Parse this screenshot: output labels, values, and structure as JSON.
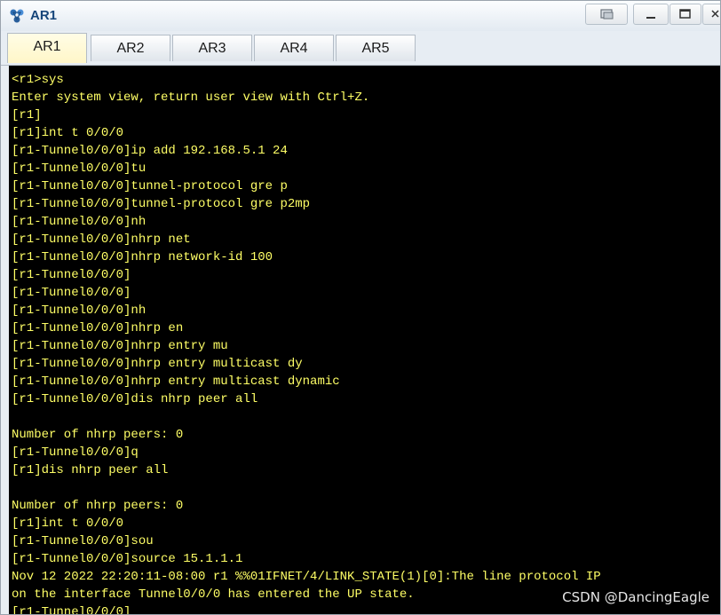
{
  "window": {
    "title": "AR1"
  },
  "tabs": [
    {
      "label": "AR1",
      "active": true
    },
    {
      "label": "AR2",
      "active": false
    },
    {
      "label": "AR3",
      "active": false
    },
    {
      "label": "AR4",
      "active": false
    },
    {
      "label": "AR5",
      "active": false
    }
  ],
  "terminal": {
    "text_color": "#ffff66",
    "background": "#000000",
    "lines": [
      "<r1>sys",
      "Enter system view, return user view with Ctrl+Z.",
      "[r1]",
      "[r1]int t 0/0/0",
      "[r1-Tunnel0/0/0]ip add 192.168.5.1 24",
      "[r1-Tunnel0/0/0]tu",
      "[r1-Tunnel0/0/0]tunnel-protocol gre p",
      "[r1-Tunnel0/0/0]tunnel-protocol gre p2mp",
      "[r1-Tunnel0/0/0]nh",
      "[r1-Tunnel0/0/0]nhrp net",
      "[r1-Tunnel0/0/0]nhrp network-id 100",
      "[r1-Tunnel0/0/0]",
      "[r1-Tunnel0/0/0]",
      "[r1-Tunnel0/0/0]nh",
      "[r1-Tunnel0/0/0]nhrp en",
      "[r1-Tunnel0/0/0]nhrp entry mu",
      "[r1-Tunnel0/0/0]nhrp entry multicast dy",
      "[r1-Tunnel0/0/0]nhrp entry multicast dynamic",
      "[r1-Tunnel0/0/0]dis nhrp peer all",
      "",
      "Number of nhrp peers: 0",
      "[r1-Tunnel0/0/0]q",
      "[r1]dis nhrp peer all",
      "",
      "Number of nhrp peers: 0",
      "[r1]int t 0/0/0",
      "[r1-Tunnel0/0/0]sou",
      "[r1-Tunnel0/0/0]source 15.1.1.1",
      "Nov 12 2022 22:20:11-08:00 r1 %%01IFNET/4/LINK_STATE(1)[0]:The line protocol IP",
      "on the interface Tunnel0/0/0 has entered the UP state.",
      "[r1-Tunnel0/0/0]"
    ]
  },
  "watermark": "CSDN @DancingEagle"
}
